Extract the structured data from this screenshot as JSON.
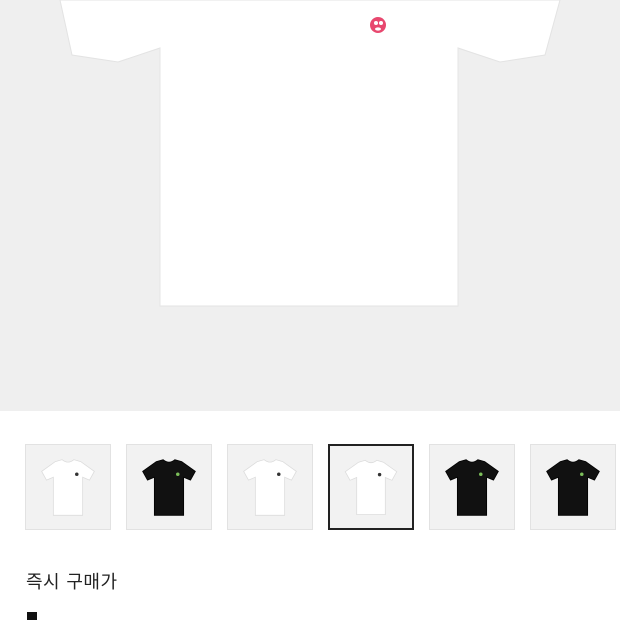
{
  "hero": {
    "shirt_color": "#ffffff",
    "logo_color": "#e8486f"
  },
  "thumbnails": [
    {
      "shirt": "white",
      "selected": false
    },
    {
      "shirt": "black",
      "selected": false
    },
    {
      "shirt": "white",
      "selected": false
    },
    {
      "shirt": "white",
      "selected": true
    },
    {
      "shirt": "black",
      "selected": false
    },
    {
      "shirt": "black",
      "selected": false
    }
  ],
  "purchase": {
    "instant_buy_label": "즉시 구매가"
  },
  "colors": {
    "background": "#efefef",
    "selected_border": "#222222",
    "text": "#222222"
  }
}
